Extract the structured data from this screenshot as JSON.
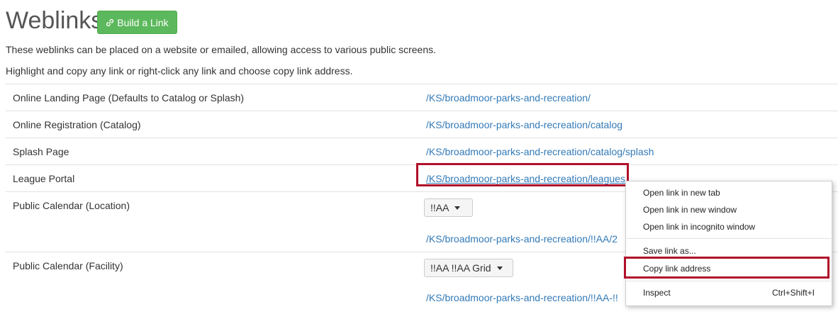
{
  "header": {
    "title": "Weblinks",
    "build_button_label": "Build a Link",
    "build_button_icon": "link-icon"
  },
  "intro": {
    "line1": "These weblinks can be placed on a website or emailed, allowing access to various public screens.",
    "line2": "Highlight and copy any link or right-click any link and choose copy link address."
  },
  "rows": [
    {
      "label": "Online Landing Page (Defaults to Catalog or Splash)",
      "link": "/KS/broadmoor-parks-and-recreation/"
    },
    {
      "label": "Online Registration (Catalog)",
      "link": "/KS/broadmoor-parks-and-recreation/catalog"
    },
    {
      "label": "Splash Page",
      "link": "/KS/broadmoor-parks-and-recreation/catalog/splash"
    },
    {
      "label": "League Portal",
      "link": "/KS/broadmoor-parks-and-recreation/leagues"
    },
    {
      "label": "Public Calendar (Location)",
      "select_value": "!!AA",
      "link": "/KS/broadmoor-parks-and-recreation/!!AA/2"
    },
    {
      "label": "Public Calendar (Facility)",
      "select_value": "!!AA !!AA Grid",
      "link": "/KS/broadmoor-parks-and-recreation/!!AA-!!"
    }
  ],
  "context_menu": {
    "items": [
      "Open link in new tab",
      "Open link in new window",
      "Open link in incognito window",
      "Save link as...",
      "Copy link address",
      "Inspect"
    ],
    "inspect_shortcut": "Ctrl+Shift+I"
  },
  "colors": {
    "accent_green": "#5cb85c",
    "link_blue": "#337ab7",
    "highlight_red": "#b0102a"
  }
}
